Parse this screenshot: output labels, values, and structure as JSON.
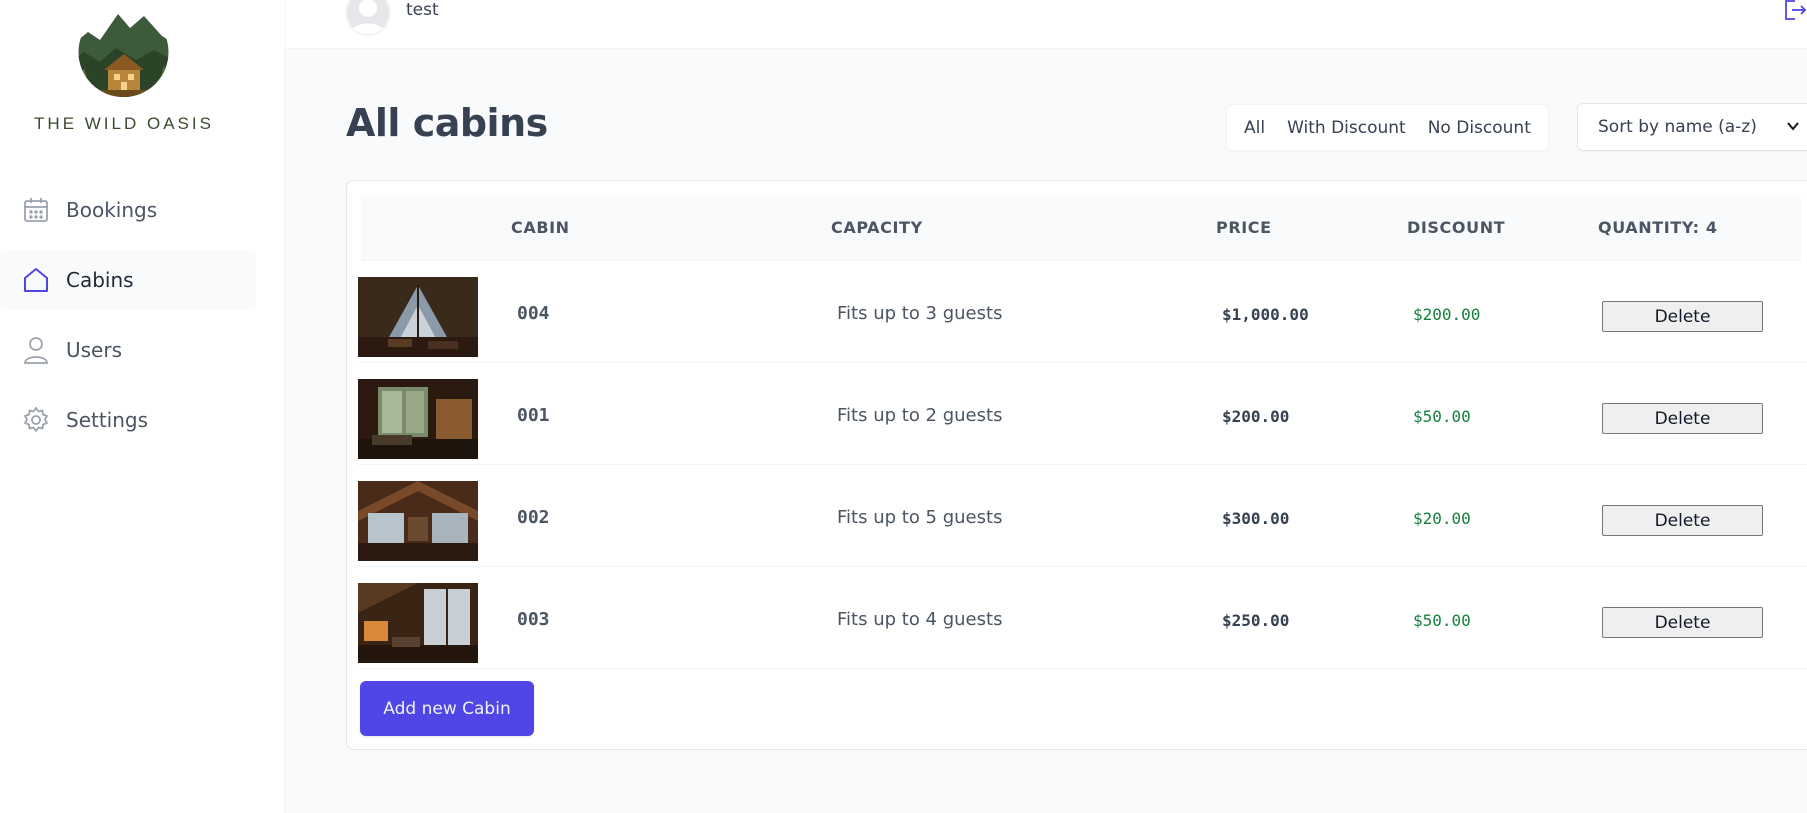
{
  "app": {
    "brand_name": "THE WILD OASIS",
    "accent_color": "#4f46e5"
  },
  "sidebar": {
    "items": [
      {
        "label": "Bookings",
        "icon": "calendar-icon",
        "active": false
      },
      {
        "label": "Cabins",
        "icon": "house-icon",
        "active": true
      },
      {
        "label": "Users",
        "icon": "user-icon",
        "active": false
      },
      {
        "label": "Settings",
        "icon": "gear-icon",
        "active": false
      }
    ]
  },
  "header": {
    "username": "test",
    "logout_icon": "logout-icon"
  },
  "main": {
    "title": "All cabins",
    "filter": {
      "options": [
        "All",
        "With Discount",
        "No Discount"
      ]
    },
    "sort": {
      "selected": "Sort by name (a-z)"
    },
    "table": {
      "columns": [
        "",
        "CABIN",
        "CAPACITY",
        "PRICE",
        "DISCOUNT",
        "QUANTITY: 4"
      ],
      "rows": [
        {
          "name": "004",
          "capacity": "Fits up to 3 guests",
          "price": "$1,000.00",
          "discount": "$200.00",
          "action": "Delete"
        },
        {
          "name": "001",
          "capacity": "Fits up to 2 guests",
          "price": "$200.00",
          "discount": "$50.00",
          "action": "Delete"
        },
        {
          "name": "002",
          "capacity": "Fits up to 5 guests",
          "price": "$300.00",
          "discount": "$20.00",
          "action": "Delete"
        },
        {
          "name": "003",
          "capacity": "Fits up to 4 guests",
          "price": "$250.00",
          "discount": "$50.00",
          "action": "Delete"
        }
      ]
    },
    "add_button_label": "Add new Cabin"
  }
}
